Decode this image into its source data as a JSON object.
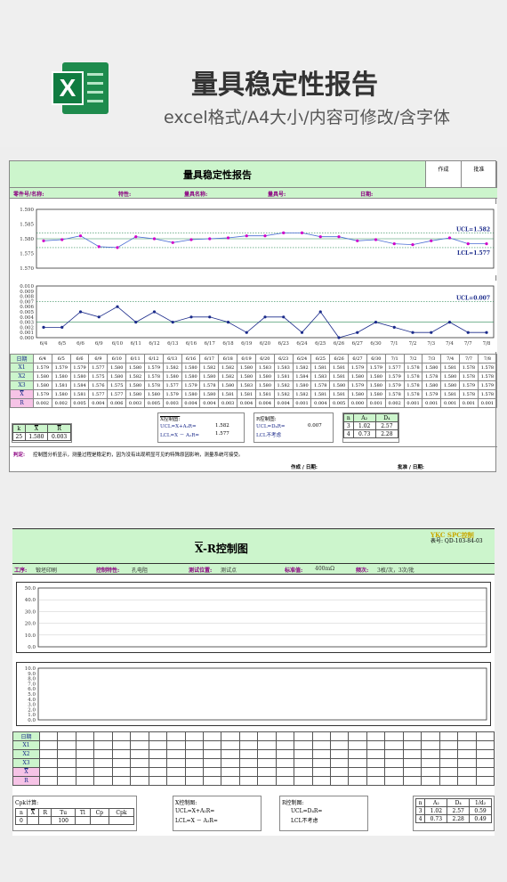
{
  "header": {
    "title": "量具稳定性报告",
    "subtitle": "excel格式/A4大小/内容可修改/含字体",
    "icon": "excel-icon",
    "icon_letter": "X"
  },
  "sheet1": {
    "title": "量具稳定性报告",
    "sign_made": "作成",
    "sign_approved": "批准",
    "info": {
      "part_no": "零件号/名称:",
      "feature": "特性:",
      "gauge_name": "量具名称:",
      "gauge_no": "量具号:",
      "date": "日期:"
    },
    "row_labels": {
      "date": "日期",
      "x1": "X1",
      "x2": "X2",
      "x3": "X3",
      "xbar": "X",
      "r": "R"
    },
    "dates": [
      "6/4",
      "6/5",
      "6/6",
      "6/9",
      "6/10",
      "6/11",
      "6/12",
      "6/13",
      "6/16",
      "6/17",
      "6/18",
      "6/19",
      "6/20",
      "6/23",
      "6/24",
      "6/25",
      "6/26",
      "6/27",
      "6/30",
      "7/1",
      "7/2",
      "7/3",
      "7/4",
      "7/7",
      "7/8"
    ],
    "x1": [
      "1.579",
      "1.579",
      "1.579",
      "1.577",
      "1.580",
      "1.580",
      "1.579",
      "1.582",
      "1.580",
      "1.582",
      "1.582",
      "1.580",
      "1.583",
      "1.583",
      "1.582",
      "1.581",
      "1.581",
      "1.579",
      "1.579",
      "1.577",
      "1.578",
      "1.580",
      "1.581",
      "1.578",
      "1.578"
    ],
    "x2": [
      "1.580",
      "1.580",
      "1.580",
      "1.575",
      "1.580",
      "1.582",
      "1.578",
      "1.580",
      "1.580",
      "1.580",
      "1.582",
      "1.580",
      "1.580",
      "1.581",
      "1.584",
      "1.583",
      "1.581",
      "1.580",
      "1.580",
      "1.579",
      "1.578",
      "1.578",
      "1.580",
      "1.578",
      "1.578"
    ],
    "x3": [
      "1.580",
      "1.581",
      "1.584",
      "1.576",
      "1.575",
      "1.580",
      "1.578",
      "1.577",
      "1.579",
      "1.578",
      "1.580",
      "1.583",
      "1.580",
      "1.582",
      "1.580",
      "1.578",
      "1.580",
      "1.579",
      "1.580",
      "1.579",
      "1.578",
      "1.580",
      "1.580",
      "1.579",
      "1.579"
    ],
    "xbar": [
      "1.579",
      "1.580",
      "1.581",
      "1.577",
      "1.577",
      "1.580",
      "1.580",
      "1.579",
      "1.580",
      "1.580",
      "1.581",
      "1.581",
      "1.581",
      "1.582",
      "1.582",
      "1.581",
      "1.581",
      "1.580",
      "1.580",
      "1.578",
      "1.578",
      "1.579",
      "1.581",
      "1.578",
      "1.578"
    ],
    "r": [
      "0.002",
      "0.002",
      "0.005",
      "0.004",
      "0.006",
      "0.003",
      "0.005",
      "0.003",
      "0.004",
      "0.004",
      "0.003",
      "0.004",
      "0.004",
      "0.004",
      "0.001",
      "0.004",
      "0.005",
      "0.000",
      "0.001",
      "0.002",
      "0.001",
      "0.001",
      "0.001",
      "0.001",
      "0.001"
    ],
    "stats": {
      "k_label": "k",
      "xbarbar_label": "X",
      "rbar_label": "R",
      "k": "25",
      "xbarbar": "1.580",
      "rbar": "0.003",
      "xbar_chart_label": "X控制图:",
      "ucl_formula": "UCL=X+A₂R=",
      "lcl_formula": "LCL=X － A₂R=",
      "ucl_value": "1.582",
      "lcl_value": "1.577",
      "r_chart_label": "R控制图:",
      "r_ucl_formula": "UCL=D₄R=",
      "r_lcl_formula": "LCL不考虑",
      "r_ucl_value": "0.007",
      "const_headers": [
        "n",
        "A₂",
        "D₄"
      ],
      "const_rows": [
        [
          "3",
          "1.02",
          "2.57"
        ],
        [
          "4",
          "0.73",
          "2.28"
        ]
      ]
    },
    "judge_label": "判定:",
    "judge_text": "控制图分析显示，测量过程是稳定的，因为没有出现明显可见的特殊原因影响，测量系统可接受。",
    "made_date": "作成 / 日期:",
    "approved_date": "批准 / 日期:"
  },
  "chart_data": [
    {
      "type": "line",
      "title": "",
      "x": [
        "6/4",
        "6/5",
        "6/6",
        "6/9",
        "6/10",
        "6/11",
        "6/12",
        "6/13",
        "6/16",
        "6/17",
        "6/18",
        "6/19",
        "6/20",
        "6/23",
        "6/24",
        "6/25",
        "6/26",
        "6/27",
        "6/30",
        "7/1",
        "7/2",
        "7/3",
        "7/4",
        "7/7",
        "7/8"
      ],
      "series": [
        {
          "values": [
            1.5793,
            1.5797,
            1.581,
            1.5773,
            1.577,
            1.5807,
            1.58,
            1.5787,
            1.5797,
            1.58,
            1.5803,
            1.581,
            1.581,
            1.582,
            1.582,
            1.5807,
            1.5807,
            1.5793,
            1.5797,
            1.5783,
            1.578,
            1.5793,
            1.5803,
            1.5783,
            1.5783
          ]
        }
      ],
      "ucl": 1.582,
      "lcl": 1.577,
      "center": 1.58,
      "ucl_label": "UCL=1.582",
      "lcl_label": "LCL=1.577",
      "ylim": [
        1.57,
        1.59
      ],
      "yticks": [
        "1.590",
        "1.585",
        "1.580",
        "1.575",
        "1.570"
      ],
      "grid": false
    },
    {
      "type": "line",
      "title": "",
      "x": [
        "6/4",
        "6/5",
        "6/6",
        "6/9",
        "6/10",
        "6/11",
        "6/12",
        "6/13",
        "6/16",
        "6/17",
        "6/18",
        "6/19",
        "6/20",
        "6/23",
        "6/24",
        "6/25",
        "6/26",
        "6/27",
        "6/30",
        "7/1",
        "7/2",
        "7/3",
        "7/4",
        "7/7",
        "7/8"
      ],
      "series": [
        {
          "values": [
            0.002,
            0.002,
            0.005,
            0.004,
            0.006,
            0.003,
            0.005,
            0.003,
            0.004,
            0.004,
            0.003,
            0.001,
            0.004,
            0.004,
            0.001,
            0.005,
            0.0,
            0.001,
            0.003,
            0.002,
            0.001,
            0.001,
            0.003,
            0.001,
            0.001
          ]
        }
      ],
      "ucl": 0.007,
      "center": 0.003,
      "ucl_label": "UCL=0.007",
      "ylim": [
        0,
        0.01
      ],
      "yticks": [
        "0.010",
        "0.009",
        "0.008",
        "0.007",
        "0.006",
        "0.005",
        "0.004",
        "0.003",
        "0.002",
        "0.001",
        "0.000"
      ],
      "grid": false
    },
    {
      "type": "line",
      "title": "",
      "series": [],
      "ylim": [
        0,
        50
      ],
      "yticks": [
        "50.0",
        "40.0",
        "30.0",
        "20.0",
        "10.0",
        "0.0"
      ],
      "grid": true
    },
    {
      "type": "line",
      "title": "",
      "series": [],
      "ylim": [
        0,
        10
      ],
      "yticks": [
        "10.0",
        "9.0",
        "8.0",
        "7.0",
        "6.0",
        "5.0",
        "4.0",
        "3.0",
        "2.0",
        "1.0",
        "0.0"
      ],
      "grid": false
    }
  ],
  "sheet2": {
    "topright": "YKC  SPC控制",
    "title": "X-R控制图",
    "code": "表号: QD-103-84-03",
    "info": {
      "process": "工序:",
      "process_val": "锻坯印刷",
      "char": "控制特性:",
      "char_val": "孔电阻",
      "pos": "测试位置:",
      "pos_val": "测试点",
      "std": "标准值:",
      "std_val": "400mΩ",
      "freq": "频次:",
      "freq_val": "3枚/次，3次/批"
    },
    "row_labels": {
      "date": "日期",
      "x1": "X1",
      "x2": "X2",
      "x3": "X3",
      "xbar": "X",
      "r": "R"
    },
    "cpk": {
      "label": "Cpk计算:",
      "headers": [
        "n",
        "X",
        "R",
        "Tu",
        "Tl",
        "Cp",
        "Cpk"
      ],
      "values": [
        "0",
        "",
        "",
        "100",
        "",
        "",
        ""
      ]
    },
    "xbar_chart_label": "X控制图:",
    "ucl_formula": "UCL=X+A₂R=",
    "lcl_formula": "LCL=X － A₂R=",
    "r_chart_label": "R控制图:",
    "r_ucl_formula": "UCL=D₄R=",
    "r_lcl_formula": "LCL不考虑",
    "const_headers": [
      "n",
      "A₂",
      "D₄",
      "1/d₂"
    ],
    "const_rows": [
      [
        "3",
        "1.02",
        "2.57",
        "0.59"
      ],
      [
        "4",
        "0.73",
        "2.28",
        "0.49"
      ]
    ]
  }
}
